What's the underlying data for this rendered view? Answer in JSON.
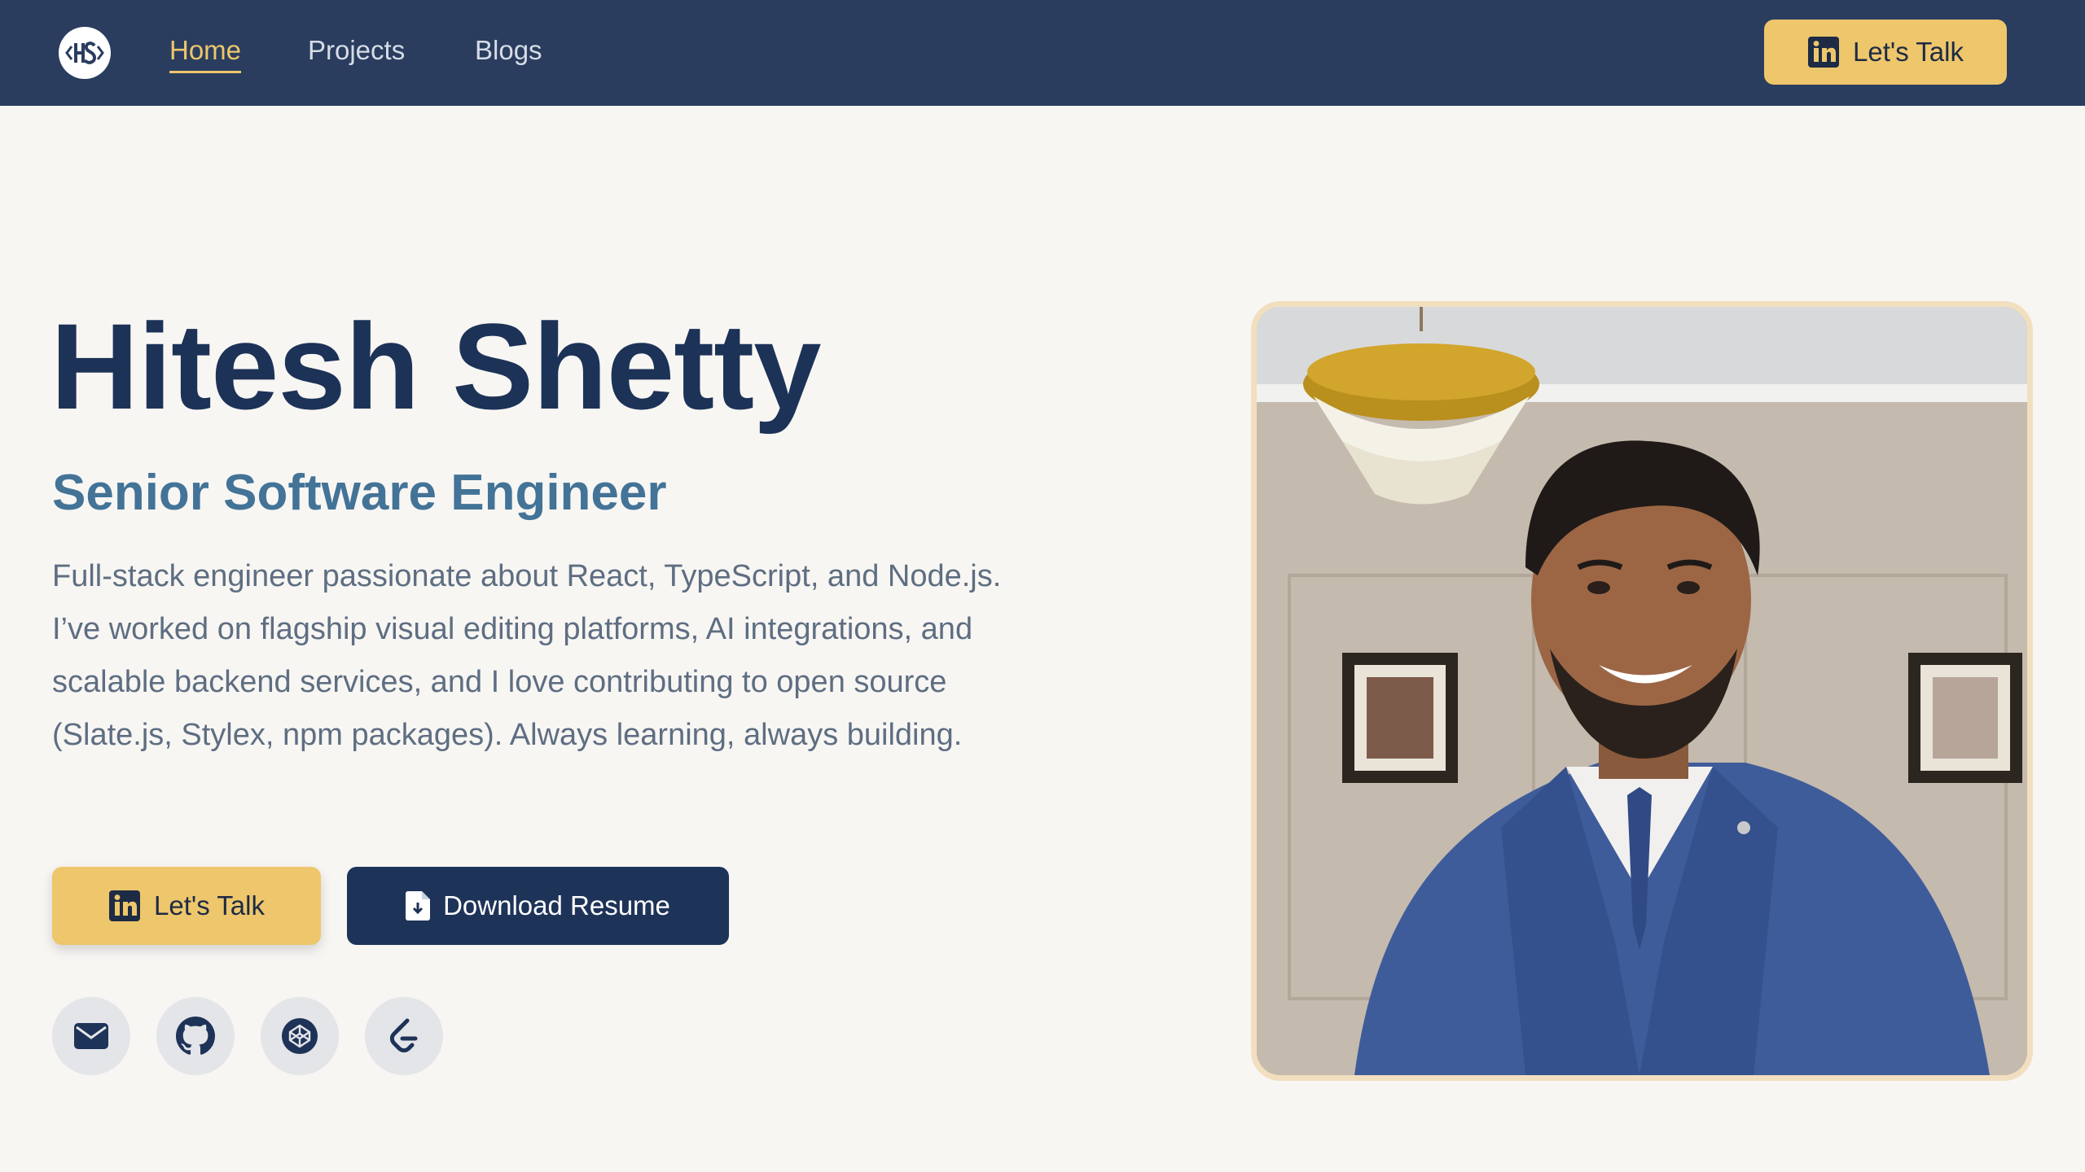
{
  "nav": {
    "logo_alt": "HS",
    "links": [
      {
        "label": "Home",
        "active": true
      },
      {
        "label": "Projects",
        "active": false
      },
      {
        "label": "Blogs",
        "active": false
      }
    ],
    "cta_label": "Let's Talk",
    "cta_icon": "linkedin-icon"
  },
  "hero": {
    "name": "Hitesh Shetty",
    "role": "Senior Software Engineer",
    "bio": "Full-stack engineer passionate about React, TypeScript, and Node.js. I’ve worked on flagship visual editing platforms, AI integrations, and scalable backend services, and I love contributing to open source (Slate.js, Stylex, npm packages). Always learning, always building.",
    "primary_cta": {
      "label": "Let's Talk",
      "icon": "linkedin-icon"
    },
    "secondary_cta": {
      "label": "Download Resume",
      "icon": "file-download-icon"
    },
    "socials": [
      {
        "name": "email",
        "icon": "mail-icon"
      },
      {
        "name": "github",
        "icon": "github-icon"
      },
      {
        "name": "codepen",
        "icon": "codepen-icon"
      },
      {
        "name": "leetcode",
        "icon": "leetcode-icon"
      }
    ]
  },
  "colors": {
    "navbar_bg": "#2a3d5f",
    "accent_gold": "#eec66c",
    "navy": "#1e3358",
    "role_blue": "#437397",
    "page_bg": "#f8f6f3"
  }
}
